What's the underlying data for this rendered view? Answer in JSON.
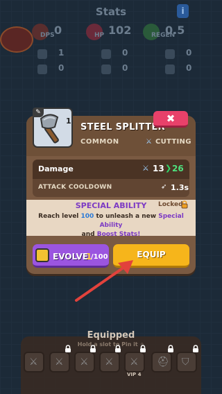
{
  "background": {
    "screen_title": "Stats",
    "info_button": "i",
    "logo_text": "",
    "stats": [
      {
        "label": "DPS",
        "value": "0",
        "color": "#5a2e2e"
      },
      {
        "label": "HP",
        "value": "102",
        "color": "#6a2a3a"
      },
      {
        "label": "REGEN",
        "value": "0.5",
        "color": "#2a5a3a"
      }
    ],
    "row1": [
      "1",
      "0",
      "0"
    ],
    "row2": [
      "0",
      "0",
      "0"
    ]
  },
  "item": {
    "level": "1",
    "name": "STEEL SPLITTER",
    "rarity": "COMMON",
    "type_label": "CUTTING",
    "close_label": "✖"
  },
  "stats": {
    "damage_label": "Damage",
    "damage_old": "13",
    "damage_new": "26",
    "cooldown_label": "ATTACK COOLDOWN",
    "cooldown_value": "1.3s"
  },
  "special": {
    "title": "SPECIAL ABILITY",
    "locked_label": "Locked",
    "text_1": "Reach level ",
    "text_level": "100",
    "text_2": " to unleash a new ",
    "text_ability": "Special Ability",
    "text_3": " and ",
    "text_boost": "Boost Stats!"
  },
  "buttons": {
    "evolve_label": "EVOLVE",
    "evolve_current": "1",
    "evolve_max": "/100",
    "equip_label": "EQUIP"
  },
  "equipped": {
    "title": "Equipped",
    "hint": "Hold a slot to Pin it ✧",
    "vip_label": "VIP 4"
  },
  "colors": {
    "panel": "#7a5a42",
    "close": "#e8416a",
    "evolve": "#9b55e0",
    "equip": "#f6b51b",
    "accent_green": "#4fe07e",
    "arrow": "#e2423c"
  }
}
